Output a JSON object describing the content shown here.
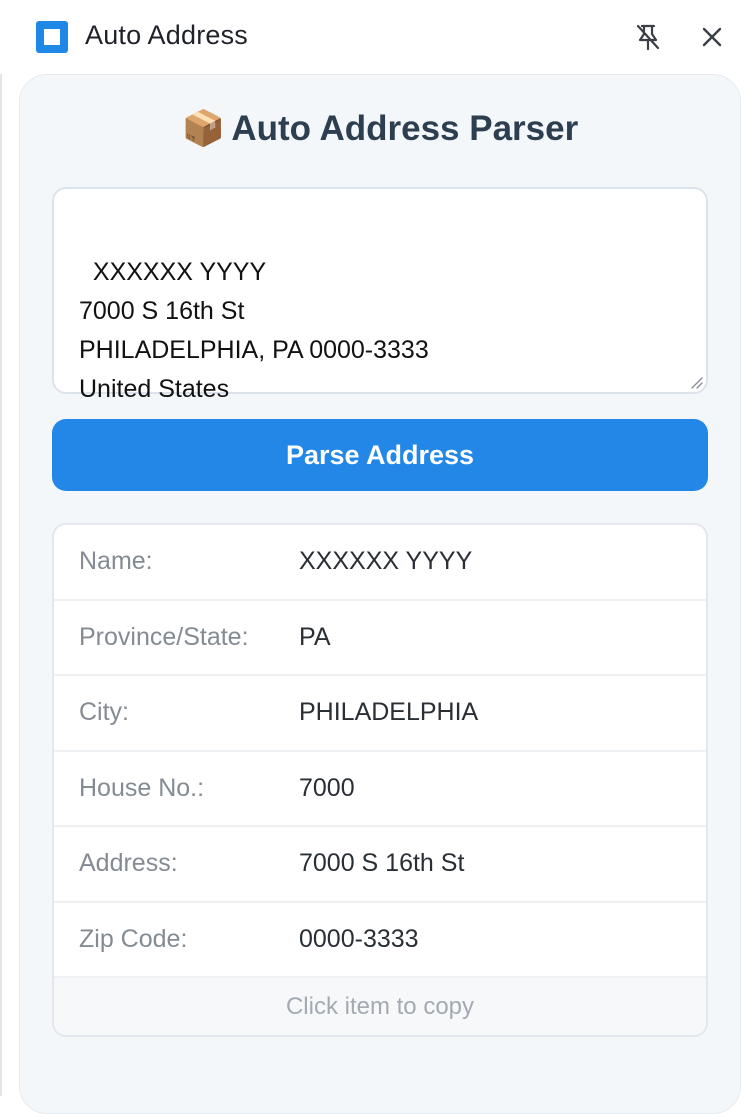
{
  "window": {
    "title": "Auto Address",
    "pin_icon": "unpin-icon",
    "close_icon": "close-icon",
    "app_icon": "square-app-icon"
  },
  "header": {
    "emoji": "📦",
    "title": "Auto Address Parser"
  },
  "input": {
    "value": "XXXXXX YYYY\n7000 S 16th St\nPHILADELPHIA, PA 0000-3333\nUnited States"
  },
  "parse_button": {
    "label": "Parse Address"
  },
  "results": {
    "rows": [
      {
        "label": "Name:",
        "value": "XXXXXX YYYY"
      },
      {
        "label": "Province/State:",
        "value": "PA"
      },
      {
        "label": "City:",
        "value": "PHILADELPHIA"
      },
      {
        "label": "House No.:",
        "value": "7000"
      },
      {
        "label": "Address:",
        "value": "7000 S 16th St"
      },
      {
        "label": "Zip Code:",
        "value": "0000-3333"
      }
    ],
    "hint": "Click item to copy"
  },
  "colors": {
    "accent": "#2287e6",
    "heading": "#2c3e50",
    "panel_bg": "#f4f7fa"
  }
}
